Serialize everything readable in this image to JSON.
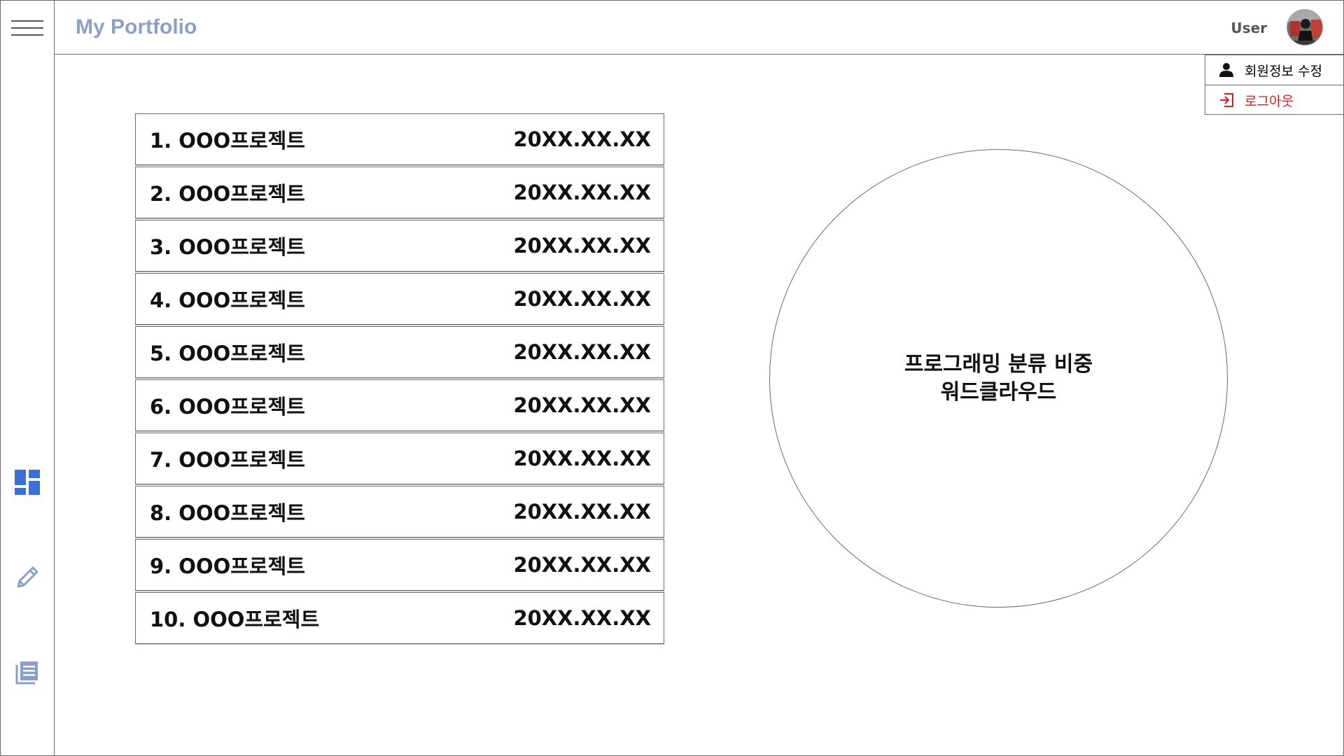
{
  "header": {
    "title": "My Portfolio",
    "user_label": "User"
  },
  "sidebar": {
    "items": [
      {
        "icon": "dashboard-icon"
      },
      {
        "icon": "pencil-icon"
      },
      {
        "icon": "document-list-icon"
      }
    ],
    "accent_color": "#3b6fd6",
    "muted_color": "#8a9fcb"
  },
  "user_menu": {
    "edit_profile": "회원정보 수정",
    "logout": "로그아웃",
    "logout_color": "#e01a1a"
  },
  "projects": [
    {
      "name": "1. OOO프로젝트",
      "date": "20XX.XX.XX"
    },
    {
      "name": "2. OOO프로젝트",
      "date": "20XX.XX.XX"
    },
    {
      "name": "3. OOO프로젝트",
      "date": "20XX.XX.XX"
    },
    {
      "name": "4. OOO프로젝트",
      "date": "20XX.XX.XX"
    },
    {
      "name": "5. OOO프로젝트",
      "date": "20XX.XX.XX"
    },
    {
      "name": "6. OOO프로젝트",
      "date": "20XX.XX.XX"
    },
    {
      "name": "7. OOO프로젝트",
      "date": "20XX.XX.XX"
    },
    {
      "name": "8. OOO프로젝트",
      "date": "20XX.XX.XX"
    },
    {
      "name": "9. OOO프로젝트",
      "date": "20XX.XX.XX"
    },
    {
      "name": "10. OOO프로젝트",
      "date": "20XX.XX.XX"
    }
  ],
  "word_cloud": {
    "line1": "프로그래밍 분류 비중",
    "line2": "워드클라우드"
  }
}
